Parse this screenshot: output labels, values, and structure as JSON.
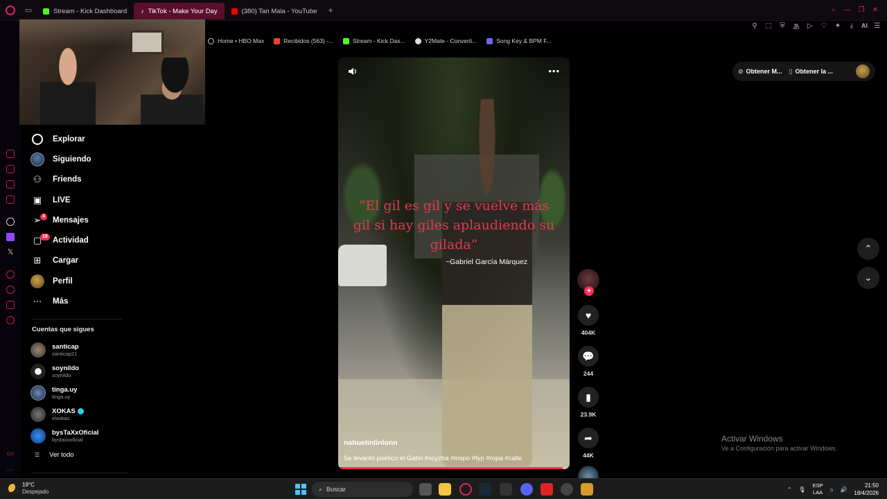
{
  "browser": {
    "tabs": [
      {
        "label": "Stream - Kick Dashboard",
        "color": "#53fc18",
        "active": false
      },
      {
        "label": "TikTok - Make Your Day",
        "color": "#ffffff",
        "active": true
      },
      {
        "label": "(380) Tan Mala - YouTube",
        "color": "#ff0000",
        "active": false
      }
    ],
    "bookmarks": [
      {
        "label": "Home • HBO Max",
        "color": "#cccccc"
      },
      {
        "label": "Recibidos (563) -...",
        "color": "#ea4335"
      },
      {
        "label": "Stream - Kick Das...",
        "color": "#53fc18"
      },
      {
        "label": "Y2Mate - Converti...",
        "color": "#dddddd"
      },
      {
        "label": "Song Key & BPM F...",
        "color": "#6c63ff"
      }
    ],
    "toolbar_ai": "AI"
  },
  "nav": {
    "items": [
      {
        "label": "Explorar",
        "icon": "compass-icon"
      },
      {
        "label": "Siguiendo",
        "icon": "following-avatar-icon"
      },
      {
        "label": "Friends",
        "icon": "friends-icon"
      },
      {
        "label": "LIVE",
        "icon": "live-icon"
      },
      {
        "label": "Mensajes",
        "icon": "messages-icon",
        "badge": "4"
      },
      {
        "label": "Actividad",
        "icon": "activity-icon",
        "badge": "18"
      },
      {
        "label": "Cargar",
        "icon": "upload-icon"
      },
      {
        "label": "Perfil",
        "icon": "profile-avatar-icon"
      },
      {
        "label": "Más",
        "icon": "more-icon"
      }
    ]
  },
  "following": {
    "heading": "Cuentas que sigues",
    "accounts": [
      {
        "name": "santicap",
        "handle": "santicap21",
        "color": "#7a6a5a",
        "verified": false
      },
      {
        "name": "soynildo",
        "handle": "soynildo",
        "color": "#e8e8e8",
        "verified": false
      },
      {
        "name": "tinga.uy",
        "handle": "tinga.uy",
        "color": "#4a6a90",
        "verified": false
      },
      {
        "name": "XOKAS",
        "handle": "elxokas",
        "color": "#444444",
        "verified": true
      },
      {
        "name": "bysTaXxOficial",
        "handle": "bystaxxoficial",
        "color": "#1d6fd0",
        "verified": false
      }
    ],
    "see_all": "Ver todo"
  },
  "video": {
    "quote": "“El gil es gil y se vuelve más gil si hay giles aplaudiendo su gilada”",
    "author": "~Gabriel García Márquez",
    "username": "nahuelinlinlonn",
    "description": "Se levantó poético el Gabri #xcyzba #inspo #fyp #ropa #calle",
    "progress": 0.97
  },
  "actions": {
    "likes": "404K",
    "comments": "244",
    "saves": "23.9K",
    "shares": "44K"
  },
  "top_actions": {
    "btn1": "Obtener M...",
    "btn2": "Obtener la ..."
  },
  "watermark": {
    "line1": "Activar Windows",
    "line2": "Ve a Configuración para activar Windows."
  },
  "taskbar": {
    "temp": "19°C",
    "weather": "Despejado",
    "search": "Buscar",
    "lang1": "ESP",
    "lang2": "LAA",
    "time": "21:50",
    "date": "18/4/2026"
  }
}
